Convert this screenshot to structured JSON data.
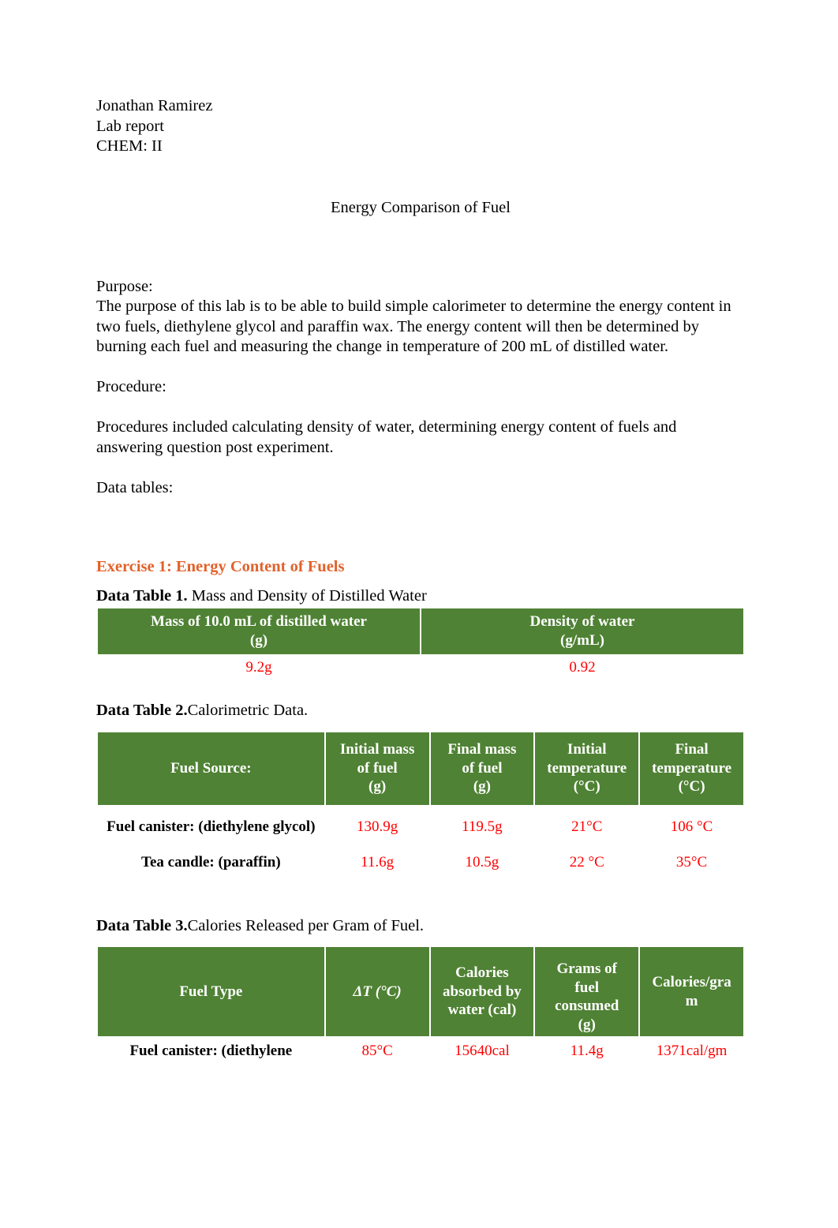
{
  "document": {
    "header_lines": [
      "Jonathan Ramirez",
      "Lab report",
      "CHEM: II"
    ],
    "title": "Energy Comparison of Fuel",
    "purpose_label": "Purpose:",
    "purpose_text": "The purpose of this lab is to be able to build simple calorimeter to determine the energy content in two fuels, diethylene glycol and paraffin wax. The energy content will then be determined by burning each fuel and measuring the change in temperature of 200 mL of distilled water.",
    "procedure_label": "Procedure:",
    "procedure_text": "Procedures included calculating density of water, determining energy content of fuels and answering question post experiment.",
    "data_tables_label": "Data tables:"
  },
  "colors": {
    "heading_orange": "#E2622B",
    "table_header_green": "#4F8234",
    "value_red": "#FF0000",
    "text_black": "#000000"
  },
  "exercise": {
    "heading": "Exercise 1: Energy Content of Fuels"
  },
  "table1": {
    "caption_bold": "Data Table 1.",
    "caption_rest": " Mass and Density of Distilled Water",
    "headers": [
      "Mass of 10.0 mL of distilled water\n(g)",
      "Density of water\n(g/mL)"
    ],
    "header_lines": [
      [
        "Mass of 10.0 mL of distilled water",
        "(g)"
      ],
      [
        "Density of water",
        "(g/mL)"
      ]
    ],
    "rows": [
      [
        "9.2g",
        "0.92"
      ]
    ]
  },
  "table2": {
    "caption_bold": "Data Table 2.",
    "caption_rest": "Calorimetric Data.",
    "header_lines": [
      [
        "Fuel Source:"
      ],
      [
        "Initial mass",
        "of fuel",
        "(g)"
      ],
      [
        "Final mass",
        "of fuel",
        "(g)"
      ],
      [
        "Initial",
        "temperature",
        "(°C)"
      ],
      [
        "Final",
        "temperature",
        "(°C)"
      ]
    ],
    "rows": [
      {
        "label": "Fuel canister: (diethylene glycol)",
        "values": [
          "130.9g",
          "119.5g",
          "21°C",
          "106 °C"
        ]
      },
      {
        "label": "Tea candle: (paraffin)",
        "values": [
          "11.6g",
          "10.5g",
          "22 °C",
          "35°C"
        ]
      }
    ]
  },
  "table3": {
    "caption_bold": "Data Table 3.",
    "caption_rest": "Calories Released per Gram of Fuel.",
    "header_lines": [
      [
        "Fuel Type"
      ],
      [
        "ΔT (°C)"
      ],
      [
        "Calories",
        "absorbed by",
        "water (cal)"
      ],
      [
        "Grams of",
        "fuel",
        "consumed",
        "(g)"
      ],
      [
        "Calories/gra",
        "m"
      ]
    ],
    "rows": [
      {
        "label": "Fuel canister: (diethylene",
        "values": [
          "85°C",
          "15640cal",
          "11.4g",
          "1371cal/gm"
        ]
      }
    ]
  }
}
